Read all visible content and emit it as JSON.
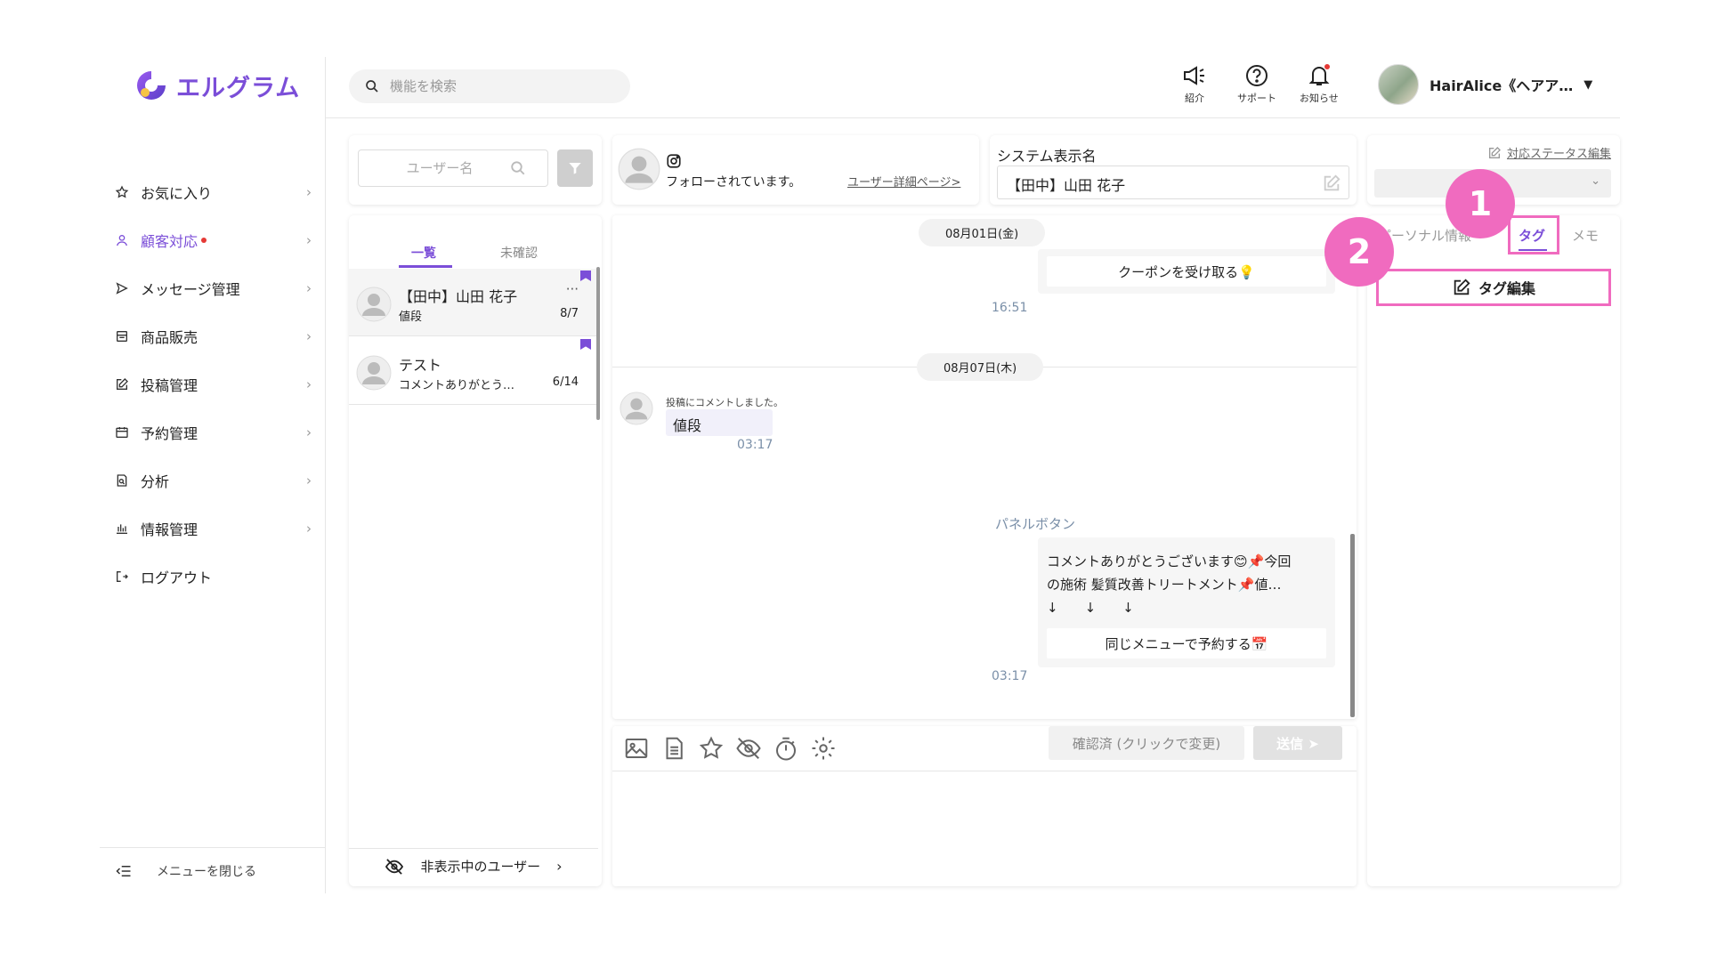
{
  "app": {
    "logo_text": "エルグラム",
    "brand_color": "#7b4ed8"
  },
  "sidebar": {
    "items": [
      {
        "label": "お気に入り",
        "icon": "star-icon"
      },
      {
        "label": "顧客対応",
        "icon": "person-icon",
        "active": true,
        "dot": true
      },
      {
        "label": "メッセージ管理",
        "icon": "send-icon"
      },
      {
        "label": "商品販売",
        "icon": "store-icon"
      },
      {
        "label": "投稿管理",
        "icon": "edit-icon"
      },
      {
        "label": "予約管理",
        "icon": "calendar-icon"
      },
      {
        "label": "分析",
        "icon": "analysis-icon"
      },
      {
        "label": "情報管理",
        "icon": "chart-icon"
      },
      {
        "label": "ログアウト",
        "icon": "logout-icon"
      }
    ],
    "close_label": "メニューを閉じる"
  },
  "header": {
    "search_placeholder": "機能を検索",
    "buttons": [
      {
        "label": "紹介",
        "icon": "megaphone-icon"
      },
      {
        "label": "サポート",
        "icon": "help-icon"
      },
      {
        "label": "お知らせ",
        "icon": "bell-icon"
      }
    ],
    "user_name": "HairAlice《ヘアア…"
  },
  "user_list": {
    "search_placeholder": "ユーザー名",
    "tabs": [
      {
        "label": "一覧",
        "active": true
      },
      {
        "label": "未確認"
      }
    ],
    "conversations": [
      {
        "name": "【田中】山田 花子",
        "preview": "値段",
        "date": "8/7",
        "menu": "···"
      },
      {
        "name": "テスト",
        "preview": "コメントありがとう…",
        "date": "6/14"
      }
    ],
    "hidden_users_label": "非表示中のユーザー"
  },
  "profile": {
    "status": "フォローされています。",
    "detail_link": "ユーザー詳細ページ>",
    "system_name_label": "システム表示名",
    "system_name_value": "【田中】山田 花子"
  },
  "chat": {
    "date1": "08月01日(金)",
    "coupon_button": "クーポンを受け取る💡",
    "time1": "16:51",
    "date2": "08月07日(木)",
    "comment_note": "投稿にコメントしました。",
    "comment_text": "値段",
    "time2": "03:17",
    "panel_label": "パネルボタン",
    "panel_text_1": "コメントありがとうございます😊📌今回",
    "panel_text_2": "の施術 髪質改善トリートメント📌値…",
    "panel_arrows": "↓　　↓　　↓",
    "panel_button": "同じメニューで予約する📅",
    "time3": "03:17"
  },
  "composer": {
    "status_button": "確認済 (クリックで変更)",
    "send_button": "送信 ➤",
    "tools": [
      "image-icon",
      "document-icon",
      "star-icon",
      "eye-off-icon",
      "timer-icon",
      "gear-icon"
    ]
  },
  "right_panel": {
    "status_edit_link": "対応ステータス編集",
    "tabs": [
      "パーソナル情報",
      "タグ",
      "メモ"
    ],
    "active_tab": "タグ",
    "tag_edit_button": "タグ編集",
    "badges": [
      "1",
      "2"
    ],
    "highlight_color": "#f06bbf"
  }
}
